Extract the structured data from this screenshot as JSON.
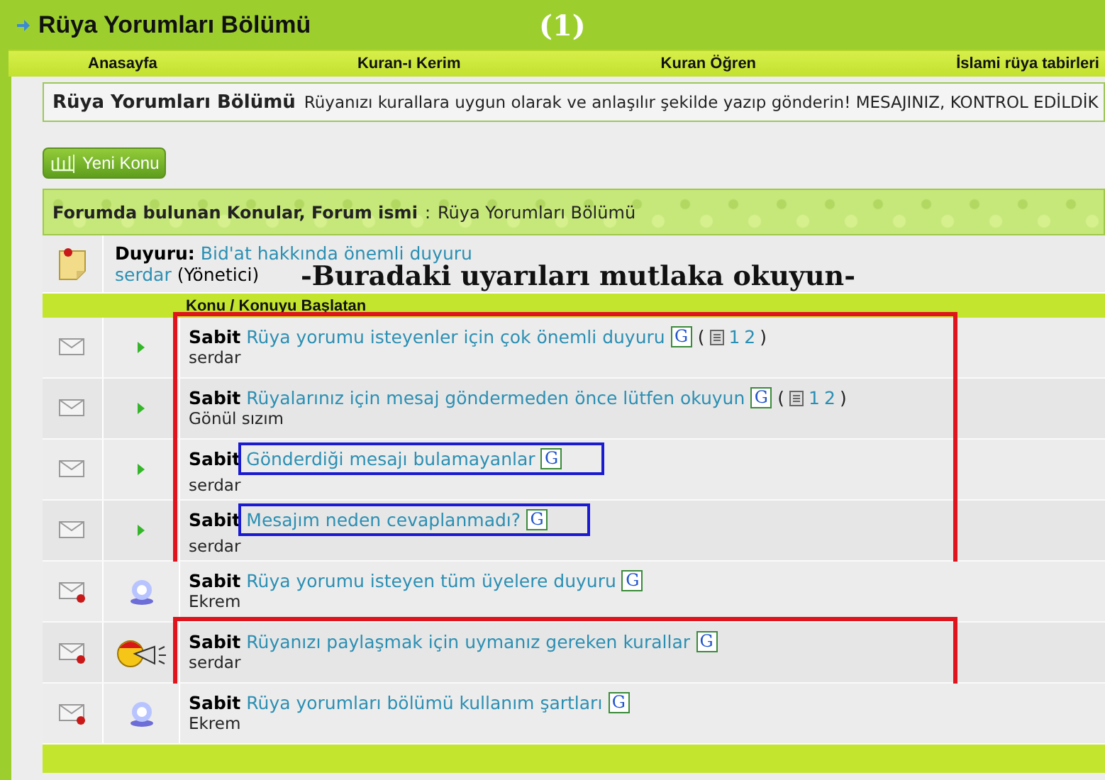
{
  "header": {
    "title": "Rüya Yorumları Bölümü",
    "marker": "(1)"
  },
  "nav": [
    "Anasayfa",
    "Kuran-ı Kerim",
    "Kuran Öğren",
    "İslami rüya tabirleri"
  ],
  "description": {
    "title": "Rüya Yorumları Bölümü",
    "text": "Rüyanızı kurallara uygun olarak ve anlaşılır şekilde yazıp gönderin! MESAJINIZ, KONTROL EDİLDİK"
  },
  "new_topic_button": "Yeni Konu",
  "forum_header": {
    "label": "Forumda bulunan Konular, Forum ismi",
    "separator": ":",
    "name": "Rüya Yorumları Bölümü"
  },
  "announcement": {
    "label": "Duyuru:",
    "link": "Bid'at hakkında önemli duyuru",
    "author": "serdar",
    "role": "(Yönetici)",
    "note": "-Buradaki uyarıları mutlaka okuyun-"
  },
  "column_header": "Konu / Konuyu Başlatan",
  "groups": [
    {
      "marked": true,
      "rows": [
        {
          "kind": "open-arrow",
          "prefix": "Sabit",
          "title": "Rüya yorumu isteyenler için çok önemli duyuru",
          "badge": "G",
          "boxed": false,
          "pages": {
            "open": "(",
            "numbers": [
              "1",
              "2"
            ],
            "close": ")"
          },
          "author": "serdar"
        },
        {
          "kind": "open-arrow",
          "prefix": "Sabit",
          "title": "Rüyalarınız için mesaj göndermeden önce lütfen okuyun",
          "badge": "G",
          "boxed": false,
          "pages": {
            "open": "(",
            "numbers": [
              "1",
              "2"
            ],
            "close": ")"
          },
          "author": "Gönül sızım"
        },
        {
          "kind": "open-arrow",
          "prefix": "Sabit",
          "title": "Gönderdiği mesajı bulamayanlar",
          "badge": "G",
          "boxed": true,
          "author": "serdar"
        },
        {
          "kind": "open-arrow",
          "prefix": "Sabit",
          "title": "Mesajım neden cevaplanmadı?",
          "badge": "G",
          "boxed": true,
          "author": "serdar"
        }
      ]
    },
    {
      "marked": false,
      "rows": [
        {
          "kind": "locked-orb",
          "prefix": "Sabit",
          "title": "Rüya yorumu isteyen tüm üyelere duyuru",
          "badge": "G",
          "boxed": false,
          "author": "Ekrem"
        }
      ]
    },
    {
      "marked": true,
      "rows": [
        {
          "kind": "locked-megaphone",
          "prefix": "Sabit",
          "title": "Rüyanızı paylaşmak için uymanız gereken kurallar",
          "badge": "G",
          "boxed": false,
          "author": "serdar"
        }
      ]
    },
    {
      "marked": false,
      "rows": [
        {
          "kind": "locked-orb",
          "prefix": "Sabit",
          "title": "Rüya yorumları bölümü kullanım şartları",
          "badge": "G",
          "boxed": false,
          "author": "Ekrem"
        }
      ]
    }
  ]
}
